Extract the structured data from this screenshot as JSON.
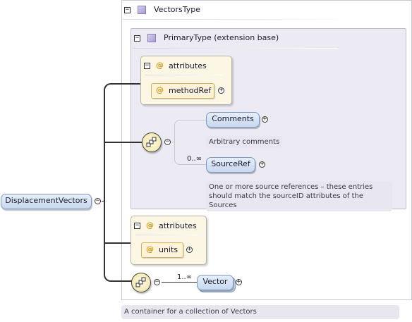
{
  "root": {
    "label": "DisplacementVectors"
  },
  "vectors_type": {
    "label": "VectorsType"
  },
  "primary_type": {
    "label": "PrimaryType (extension base)"
  },
  "attributes_group_1": {
    "label": "attributes",
    "attribute": "methodRef"
  },
  "comments": {
    "label": "Comments",
    "doc": "Arbitrary comments"
  },
  "source_ref": {
    "label": "SourceRef",
    "cardinality": "0..∞",
    "doc_line1": "One or more source references – these entries",
    "doc_line2": "should match the sourceID attributes of the Sources"
  },
  "attributes_group_2": {
    "label": "attributes",
    "attribute": "units"
  },
  "vector": {
    "label": "Vector",
    "cardinality": "1..∞"
  },
  "footer_doc": "A container for a collection of Vectors",
  "symbols": {
    "minus": "−",
    "plus": "+",
    "at": "@"
  },
  "colors": {
    "element_fill": "#c8d8ee",
    "attribute_fill": "#fdf3da",
    "type_panel": "#ecebf3",
    "doc_fill": "#e8e6ee"
  }
}
